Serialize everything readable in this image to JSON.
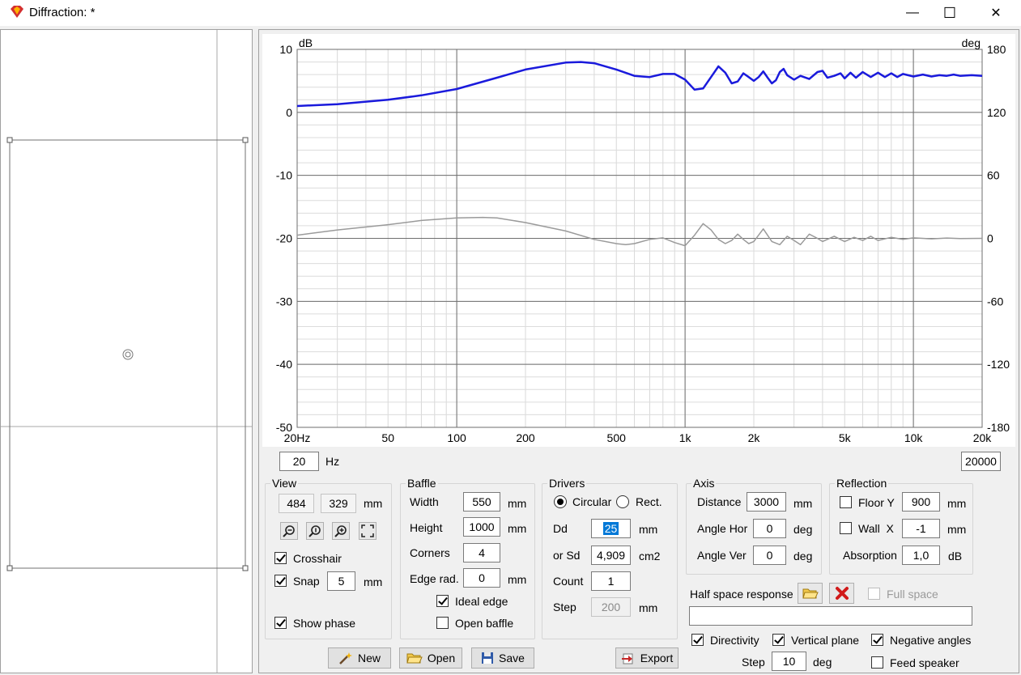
{
  "window": {
    "title": "Diffraction: *",
    "minimize": "—",
    "maximize": "☐",
    "close": "✕"
  },
  "chart_data": {
    "type": "line",
    "xscale": "log",
    "xlim": [
      20,
      20000
    ],
    "ylim": [
      -50,
      10
    ],
    "y2lim": [
      -180,
      180
    ],
    "ylabel": "dB",
    "y2label": "deg",
    "grid": true,
    "x_ticks": [
      "20Hz",
      "50",
      "100",
      "200",
      "500",
      "1k",
      "2k",
      "5k",
      "10k",
      "20k"
    ],
    "x_tick_values": [
      20,
      50,
      100,
      200,
      500,
      1000,
      2000,
      5000,
      10000,
      20000
    ],
    "y_ticks": [
      "10",
      "0",
      "-10",
      "-20",
      "-30",
      "-40",
      "-50"
    ],
    "y_tick_values": [
      10,
      0,
      -10,
      -20,
      -30,
      -40,
      -50
    ],
    "y2_ticks": [
      "180",
      "120",
      "60",
      "0",
      "-60",
      "-120",
      "-180"
    ],
    "y2_tick_values": [
      180,
      120,
      60,
      0,
      -60,
      -120,
      -180
    ],
    "series": [
      {
        "axis": "left",
        "color": "#1a1adc",
        "x": [
          20,
          30,
          50,
          70,
          100,
          150,
          200,
          300,
          350,
          400,
          500,
          600,
          700,
          800,
          900,
          1000,
          1100,
          1200,
          1300,
          1400,
          1500,
          1600,
          1700,
          1800,
          1900,
          2000,
          2100,
          2200,
          2300,
          2400,
          2500,
          2600,
          2700,
          2800,
          3000,
          3200,
          3500,
          3800,
          4000,
          4200,
          4500,
          4800,
          5000,
          5300,
          5600,
          6000,
          6500,
          7000,
          7500,
          8000,
          8500,
          9000,
          10000,
          11000,
          12000,
          13000,
          14000,
          15000,
          16000,
          18000,
          20000
        ],
        "y": [
          1.0,
          1.3,
          2.0,
          2.7,
          3.7,
          5.5,
          6.8,
          7.9,
          8.0,
          7.8,
          6.8,
          5.8,
          5.6,
          6.1,
          6.1,
          5.2,
          3.6,
          3.8,
          5.6,
          7.3,
          6.3,
          4.6,
          4.9,
          6.2,
          5.6,
          5.0,
          5.6,
          6.5,
          5.5,
          4.6,
          5.1,
          6.4,
          6.9,
          5.9,
          5.2,
          5.8,
          5.3,
          6.4,
          6.6,
          5.5,
          5.8,
          6.2,
          5.4,
          6.3,
          5.5,
          6.4,
          5.6,
          6.3,
          5.6,
          6.2,
          5.6,
          6.1,
          5.7,
          6.0,
          5.7,
          5.9,
          5.8,
          6.0,
          5.8,
          5.9,
          5.8
        ]
      },
      {
        "axis": "right",
        "color": "#9a9a9a",
        "x": [
          20,
          30,
          50,
          70,
          100,
          130,
          150,
          200,
          300,
          400,
          500,
          550,
          600,
          700,
          800,
          900,
          1000,
          1100,
          1200,
          1300,
          1400,
          1500,
          1600,
          1700,
          1800,
          1900,
          2000,
          2200,
          2400,
          2600,
          2800,
          3000,
          3200,
          3500,
          3800,
          4000,
          4500,
          5000,
          5500,
          6000,
          6500,
          7000,
          8000,
          9000,
          10000,
          12000,
          14000,
          16000,
          20000
        ],
        "y": [
          3,
          8,
          13,
          17,
          19.5,
          20,
          19.5,
          15,
          7,
          -1,
          -5,
          -6,
          -5,
          -1,
          0.5,
          -4,
          -7,
          3,
          14,
          8,
          -1,
          -5,
          -2,
          4,
          -1,
          -5,
          -3,
          9,
          -3,
          -6,
          2,
          -2,
          -6,
          4,
          0,
          -3,
          2,
          -3,
          1,
          -2,
          2,
          -2,
          1,
          -1,
          0.5,
          -0.5,
          0.3,
          -0.2,
          0
        ]
      }
    ]
  },
  "left_panel": {
    "crosshair_symbol": "⊕"
  },
  "freq": {
    "min": "20",
    "unit": "Hz",
    "max": "20000"
  },
  "view": {
    "title": "View",
    "w": "484",
    "h": "329",
    "unit": "mm",
    "tools": [
      "zoom-out-icon",
      "zoom-1-icon",
      "zoom-in-icon",
      "fit-icon"
    ],
    "crosshair": "Crosshair",
    "snap": "Snap",
    "snap_value": "5",
    "snap_unit": "mm",
    "show_phase": "Show phase"
  },
  "baffle": {
    "title": "Baffle",
    "width_label": "Width",
    "width": "550",
    "width_unit": "mm",
    "height_label": "Height",
    "height": "1000",
    "height_unit": "mm",
    "corners_label": "Corners",
    "corners": "4",
    "edge_label": "Edge rad.",
    "edge": "0",
    "edge_unit": "mm",
    "ideal_edge": "Ideal edge",
    "open_baffle": "Open baffle"
  },
  "drivers": {
    "title": "Drivers",
    "circular": "Circular",
    "rect": "Rect.",
    "dd_label": "Dd",
    "dd": "25",
    "dd_unit": "mm",
    "sd_label": "or Sd",
    "sd": "4,909",
    "sd_unit": "cm2",
    "count_label": "Count",
    "count": "1",
    "step_label": "Step",
    "step": "200",
    "step_unit": "mm"
  },
  "axis": {
    "title": "Axis",
    "distance_label": "Distance",
    "distance": "3000",
    "distance_unit": "mm",
    "hor_label": "Angle Hor",
    "hor": "0",
    "hor_unit": "deg",
    "ver_label": "Angle Ver",
    "ver": "0",
    "ver_unit": "deg"
  },
  "reflection": {
    "title": "Reflection",
    "floor_label": "Floor Y",
    "floor": "900",
    "floor_unit": "mm",
    "wall_label": "Wall  X",
    "wall": "-1",
    "wall_unit": "mm",
    "absorption_label": "Absorption",
    "absorption": "1,0",
    "absorption_unit": "dB"
  },
  "half_space": {
    "label": "Half space response",
    "full_space": "Full space",
    "value": ""
  },
  "options": {
    "directivity": "Directivity",
    "vertical_plane": "Vertical plane",
    "negative_angles": "Negative angles",
    "step_label": "Step",
    "step": "10",
    "step_unit": "deg",
    "feed_speaker": "Feed speaker"
  },
  "buttons": {
    "new": "New",
    "open": "Open",
    "save": "Save",
    "export": "Export"
  },
  "colors": {
    "accent": "#0078d7",
    "delete": "#d11a1a",
    "folder": "#f2c94c"
  }
}
